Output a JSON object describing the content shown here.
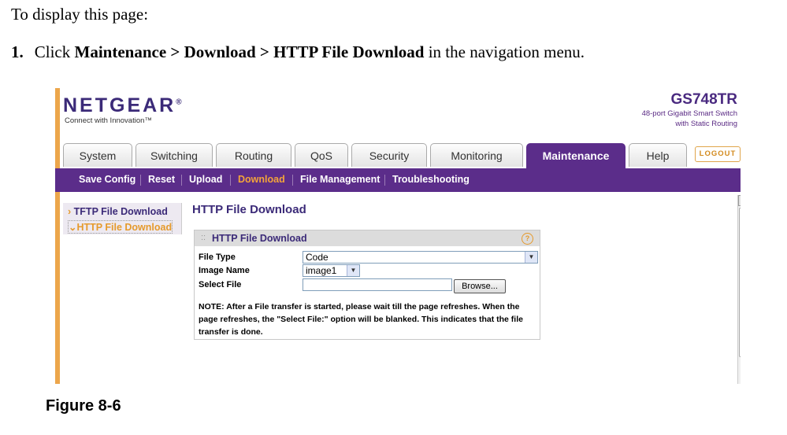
{
  "doc": {
    "intro": "To display this page:",
    "step_number": "1.",
    "step_prefix": "Click ",
    "step_path": "Maintenance > Download > HTTP File Download",
    "step_suffix": " in the navigation menu.",
    "figure_caption": "Figure 8-6"
  },
  "app": {
    "logo": "NETGEAR",
    "logo_mark": "®",
    "tagline": "Connect with Innovation™",
    "model_name": "GS748TR",
    "model_desc_line1": "48-port Gigabit Smart Switch",
    "model_desc_line2": "with Static Routing",
    "logout_label": "LOGOUT"
  },
  "tabs": [
    {
      "label": "System"
    },
    {
      "label": "Switching"
    },
    {
      "label": "Routing"
    },
    {
      "label": "QoS"
    },
    {
      "label": "Security"
    },
    {
      "label": "Monitoring"
    },
    {
      "label": "Maintenance",
      "active": true
    },
    {
      "label": "Help"
    }
  ],
  "subnav": [
    {
      "label": "Save Config"
    },
    {
      "label": "Reset"
    },
    {
      "label": "Upload"
    },
    {
      "label": "Download",
      "active": true
    },
    {
      "label": "File Management"
    },
    {
      "label": "Troubleshooting"
    }
  ],
  "leftnav": {
    "items": [
      {
        "label": "TFTP File Download"
      },
      {
        "label": "HTTP File Download",
        "active": true
      }
    ]
  },
  "main": {
    "page_title": "HTTP File Download",
    "panel_title": "HTTP File Download",
    "file_type_label": "File Type",
    "file_type_value": "Code",
    "image_name_label": "Image Name",
    "image_name_value": "image1",
    "select_file_label": "Select File",
    "select_file_value": "",
    "browse_label": "Browse...",
    "note": "NOTE: After a File transfer is started, please wait till the page refreshes. When the page refreshes, the \"Select File:\" option will be blanked. This indicates that the file transfer is done."
  },
  "colors": {
    "brand_purple": "#5b2d8a",
    "accent_orange": "#e59a2c"
  }
}
